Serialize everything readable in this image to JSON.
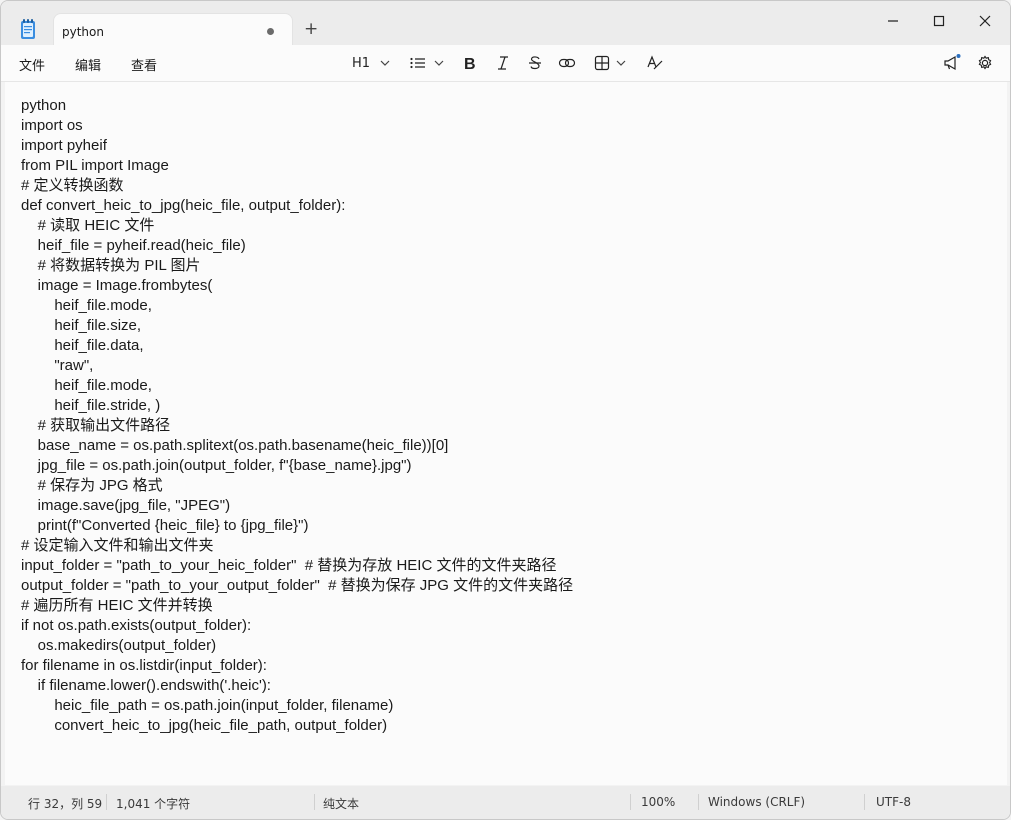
{
  "tab": {
    "title": "python"
  },
  "menu": {
    "file": "文件",
    "edit": "编辑",
    "view": "查看"
  },
  "toolbar": {
    "heading": "H1"
  },
  "code_lines": [
    "python",
    "import os",
    "import pyheif",
    "from PIL import Image",
    "# 定义转换函数",
    "def convert_heic_to_jpg(heic_file, output_folder):",
    "    # 读取 HEIC 文件",
    "    heif_file = pyheif.read(heic_file)",
    "    # 将数据转换为 PIL 图片",
    "    image = Image.frombytes(",
    "        heif_file.mode,",
    "        heif_file.size,",
    "        heif_file.data,",
    "        \"raw\",",
    "        heif_file.mode,",
    "        heif_file.stride, )",
    "    # 获取输出文件路径",
    "    base_name = os.path.splitext(os.path.basename(heic_file))[0]",
    "    jpg_file = os.path.join(output_folder, f\"{base_name}.jpg\")",
    "    # 保存为 JPG 格式",
    "    image.save(jpg_file, \"JPEG\")",
    "    print(f\"Converted {heic_file} to {jpg_file}\")",
    "# 设定输入文件和输出文件夹",
    "input_folder = \"path_to_your_heic_folder\"  # 替换为存放 HEIC 文件的文件夹路径",
    "output_folder = \"path_to_your_output_folder\"  # 替换为保存 JPG 文件的文件夹路径",
    "# 遍历所有 HEIC 文件并转换",
    "if not os.path.exists(output_folder):",
    "    os.makedirs(output_folder)",
    "for filename in os.listdir(input_folder):",
    "    if filename.lower().endswith('.heic'):",
    "        heic_file_path = os.path.join(input_folder, filename)",
    "        convert_heic_to_jpg(heic_file_path, output_folder)"
  ],
  "status": {
    "position": "行 32，列 59",
    "char_count": "1,041 个字符",
    "format": "纯文本",
    "zoom": "100%",
    "line_ending": "Windows (CRLF)",
    "encoding": "UTF-8"
  },
  "colors": {
    "accent": "#1b6ec2",
    "notification_dot": "#2b6fbf"
  }
}
